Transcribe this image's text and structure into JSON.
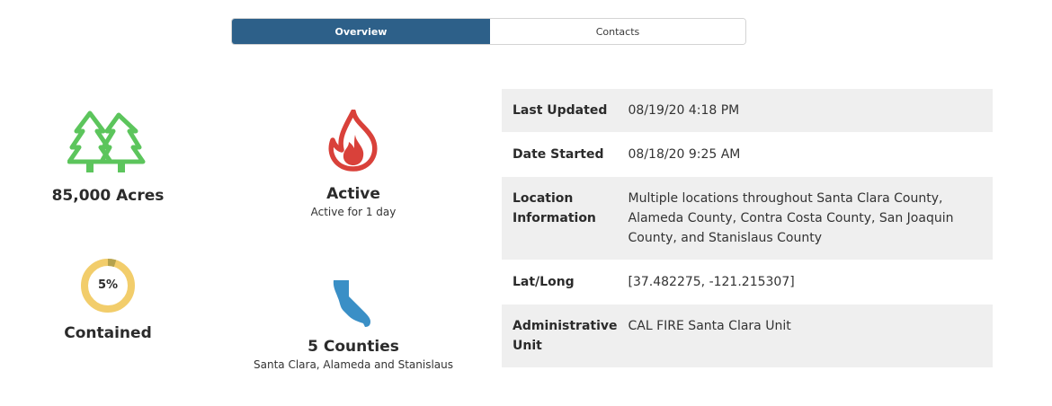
{
  "tabs": [
    {
      "label": "Overview",
      "active": true
    },
    {
      "label": "Contacts",
      "active": false
    }
  ],
  "stats": {
    "acres": {
      "title": "85,000 Acres",
      "icon": "trees-icon",
      "color": "#5cc55c"
    },
    "status": {
      "title": "Active",
      "subtitle": "Active for 1 day",
      "icon": "flame-icon",
      "color": "#d9413a"
    },
    "containment": {
      "title": "Contained",
      "percent_label": "5%",
      "percent_value": 5,
      "ring_color": "#f2cd6b",
      "fill_color": "#b5a24d"
    },
    "counties": {
      "title": "5 Counties",
      "subtitle": "Santa Clara, Alameda and Stanislaus",
      "icon": "california-map-icon",
      "color": "#3a8fc6"
    }
  },
  "info": [
    {
      "key": "Last Updated",
      "value": "08/19/20 4:18 PM"
    },
    {
      "key": "Date Started",
      "value": "08/18/20 9:25 AM"
    },
    {
      "key": "Location Information",
      "value": "Multiple locations throughout Santa Clara County, Alameda County, Contra Costa County, San Joaquin County, and Stanislaus County"
    },
    {
      "key": "Lat/Long",
      "value": "[37.482275, -121.215307]"
    },
    {
      "key": "Administrative Unit",
      "value": "CAL FIRE Santa Clara Unit"
    }
  ]
}
